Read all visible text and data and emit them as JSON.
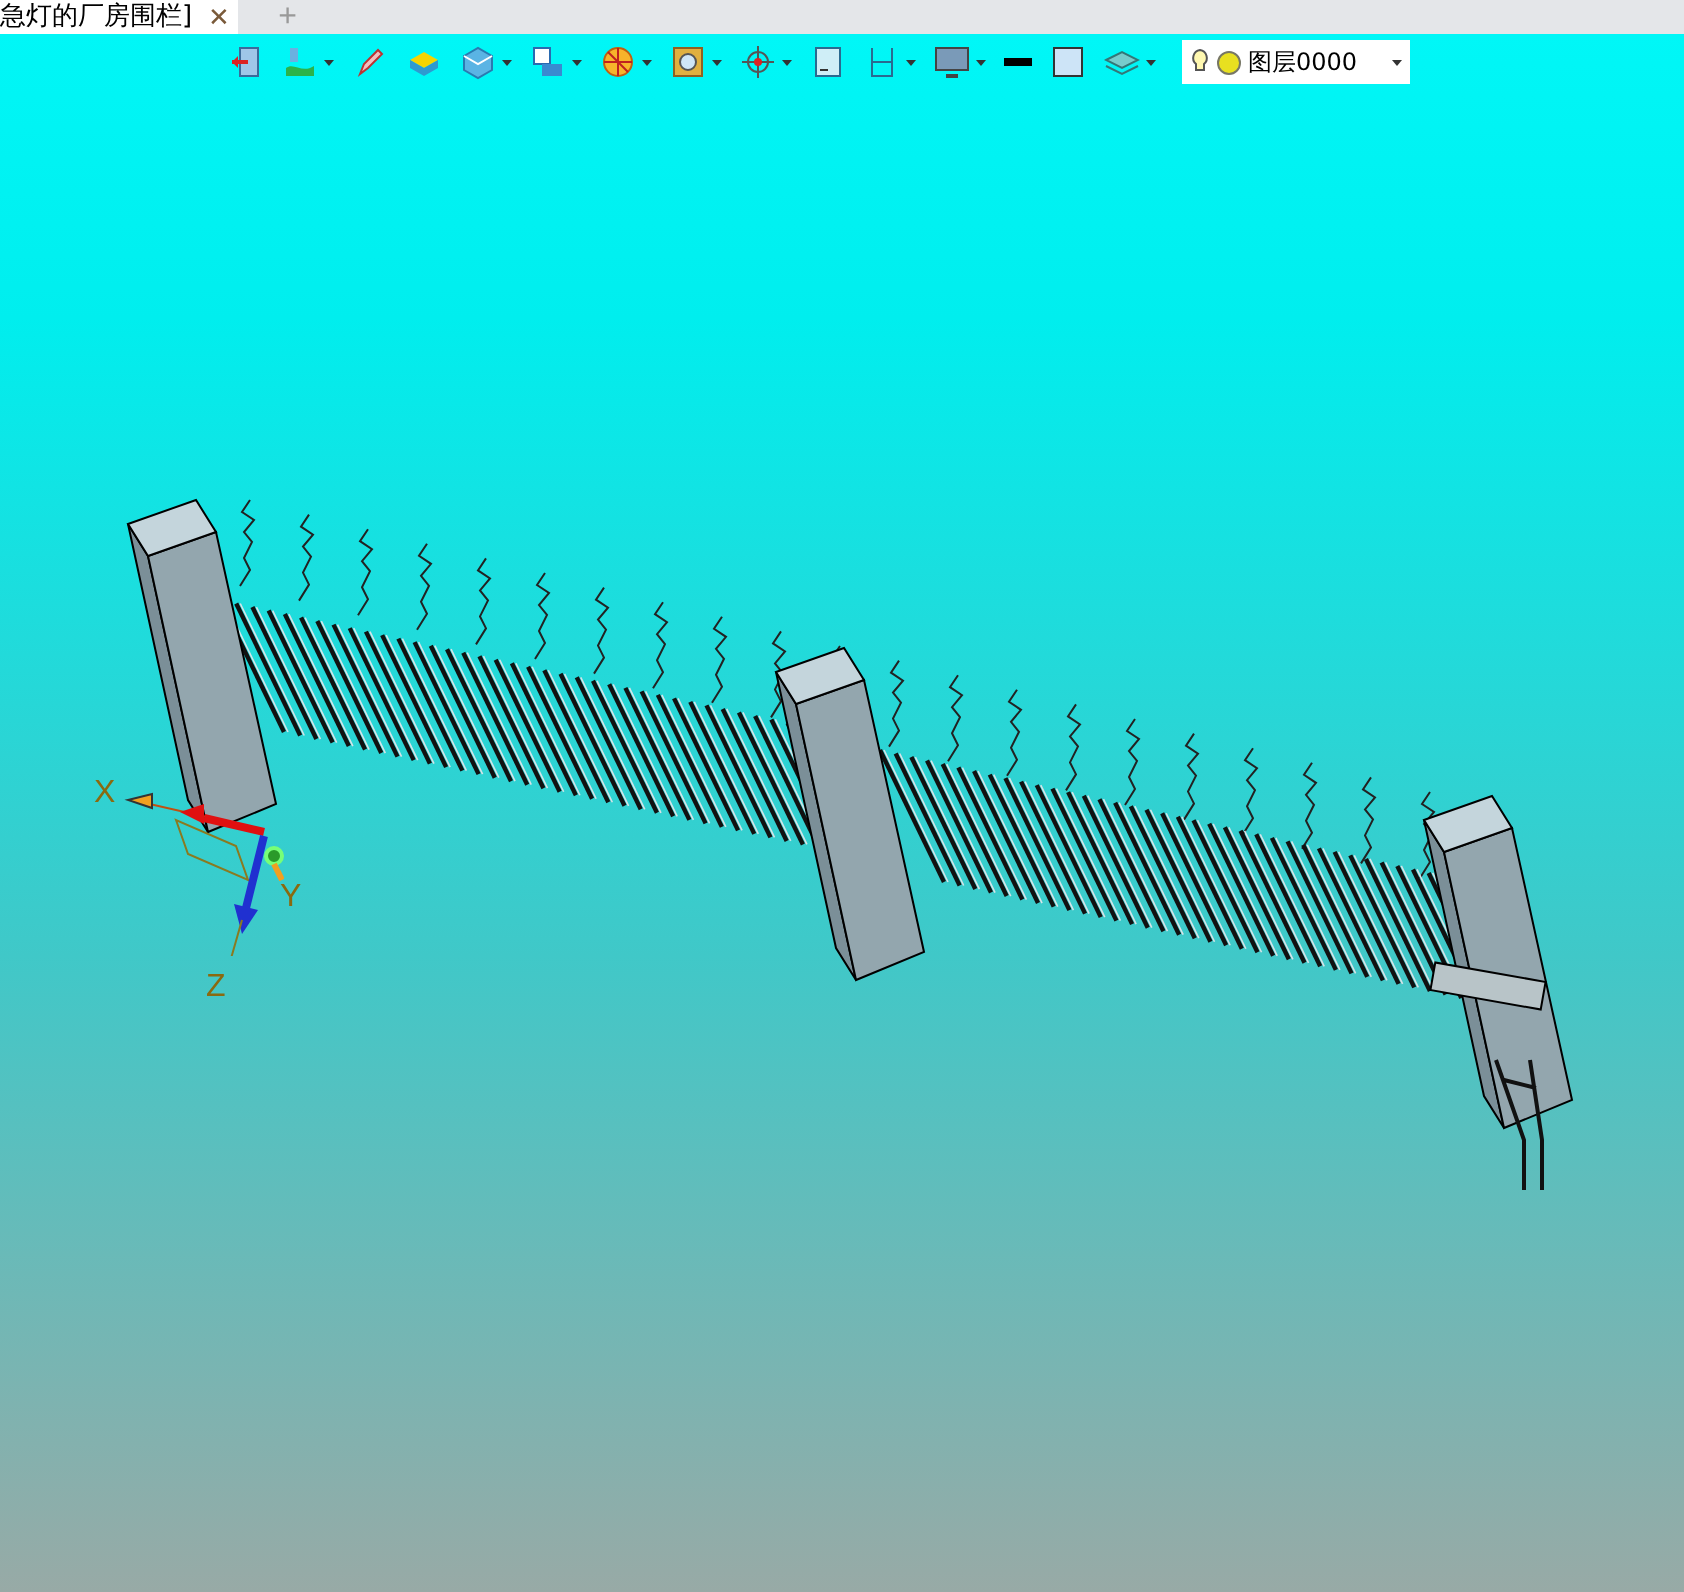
{
  "tabs": [
    {
      "label": "急灯的厂房围栏]",
      "close": "✕",
      "selected": true
    }
  ],
  "new_tab": "+",
  "toolbar": [
    {
      "kind": "exit",
      "dropdown": false
    },
    {
      "kind": "paint",
      "dropdown": true
    },
    {
      "kind": "pen",
      "dropdown": false
    },
    {
      "kind": "plate",
      "dropdown": false
    },
    {
      "kind": "cube",
      "dropdown": true
    },
    {
      "kind": "view",
      "dropdown": true
    },
    {
      "kind": "pie",
      "dropdown": true
    },
    {
      "kind": "zoom",
      "dropdown": true
    },
    {
      "kind": "cross",
      "dropdown": true
    },
    {
      "kind": "frame",
      "dropdown": false
    },
    {
      "kind": "bracket",
      "dropdown": true
    },
    {
      "kind": "monitor",
      "dropdown": true
    },
    {
      "kind": "line",
      "dropdown": false
    },
    {
      "kind": "fill",
      "dropdown": false
    },
    {
      "kind": "layers",
      "dropdown": true
    }
  ],
  "layer_select": {
    "value": "图层0000"
  },
  "axes": [
    {
      "label": "X"
    },
    {
      "label": "Y"
    },
    {
      "label": "Z"
    }
  ]
}
